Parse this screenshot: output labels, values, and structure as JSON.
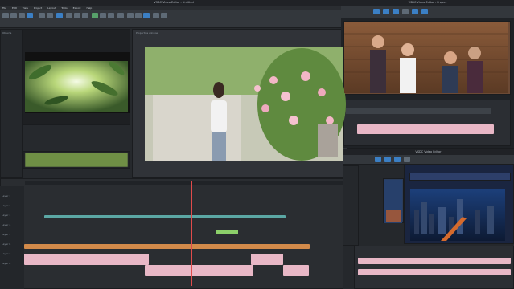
{
  "main_window": {
    "title": "VSDC Video Editor - Untitled",
    "menu": [
      "File",
      "Edit",
      "View",
      "Project",
      "Layout",
      "Tools",
      "Export",
      "Help"
    ],
    "objects_label": "Objects",
    "properties_label": "Properties window",
    "track_names": [
      "Layer 1",
      "Layer 2",
      "Layer 3",
      "Layer 4",
      "Layer 5",
      "Layer 6",
      "Layer 7",
      "Layer 8"
    ]
  },
  "second_window": {
    "title": "VSDC Video Editor - Project"
  },
  "third_window": {
    "title": "VSDC Video Editor"
  },
  "colors": {
    "accent": "#3b7fc4",
    "clip_pink": "#e8b7c6",
    "clip_teal": "#5ba7a4",
    "clip_orange": "#d28a4a",
    "clip_green": "#8ccf6a"
  },
  "icons": [
    "play-icon",
    "pause-icon",
    "scissors-icon",
    "zoom-icon",
    "settings-icon",
    "close-icon"
  ]
}
